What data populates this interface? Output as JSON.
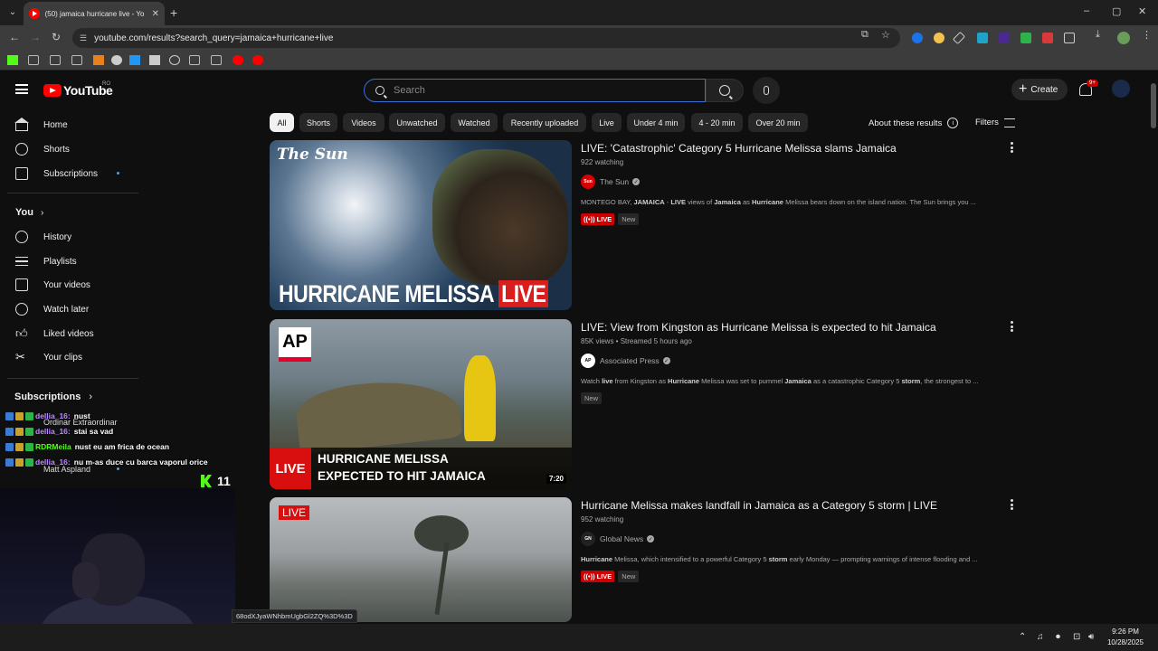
{
  "browser": {
    "tab_title": "(50) jamaica hurricane live - Yo",
    "url": "youtube.com/results?search_query=jamaica+hurricane+live",
    "window_controls": {
      "minimize": "–",
      "maximize": "▢",
      "close": "✕"
    }
  },
  "header": {
    "logo_text": "YouTube",
    "country_code": "RO",
    "search_placeholder": "Search",
    "create_label": "Create",
    "notification_count": "9+"
  },
  "sidebar": {
    "main": [
      {
        "label": "Home",
        "icon": "home-icon"
      },
      {
        "label": "Shorts",
        "icon": "shorts-icon"
      },
      {
        "label": "Subscriptions",
        "icon": "subscriptions-icon"
      }
    ],
    "you_heading": "You",
    "you_items": [
      {
        "label": "History",
        "icon": "history-icon"
      },
      {
        "label": "Playlists",
        "icon": "playlists-icon"
      },
      {
        "label": "Your videos",
        "icon": "your-videos-icon"
      },
      {
        "label": "Watch later",
        "icon": "watch-later-icon"
      },
      {
        "label": "Liked videos",
        "icon": "liked-videos-icon"
      },
      {
        "label": "Your clips",
        "icon": "clips-icon"
      }
    ],
    "subscriptions_heading": "Subscriptions",
    "subscriptions": [
      "Ordinar Extraordinar",
      "Matt Aspland"
    ]
  },
  "chips": [
    "All",
    "Shorts",
    "Videos",
    "Unwatched",
    "Watched",
    "Recently uploaded",
    "Live",
    "Under 4 min",
    "4 - 20 min",
    "Over 20 min"
  ],
  "about_results": "About these results",
  "filters_label": "Filters",
  "results": [
    {
      "title": "LIVE: 'Catastrophic' Category 5 Hurricane Melissa slams Jamaica",
      "meta": "922 watching",
      "channel": "The Sun",
      "channel_avatar_text": "Sun",
      "desc_html": "MONTEGO BAY, <b>JAMAICA</b> - <b>LIVE</b> views of <b>Jamaica</b> as <b>Hurricane</b> Melissa bears down on the island nation. The Sun brings you ...",
      "live_badge": "LIVE",
      "new_badge": "New",
      "thumb_brand": "The Sun",
      "thumb_caption": "HURRICANE MELISSA",
      "thumb_caption_live": "LIVE"
    },
    {
      "title": "LIVE: View from Kingston as Hurricane Melissa is expected to hit Jamaica",
      "meta": "85K views • Streamed 5 hours ago",
      "channel": "Associated Press",
      "channel_avatar_text": "AP",
      "desc_html": "Watch <b>live</b> from Kingston as <b>Hurricane</b> Melissa was set to pummel <b>Jamaica</b> as a catastrophic Category 5 <b>storm</b>, the strongest to ...",
      "new_badge": "New",
      "thumb_brand": "AP",
      "thumb_live": "LIVE",
      "thumb_caption_1": "HURRICANE MELISSA",
      "thumb_caption_2": "EXPECTED TO HIT JAMAICA",
      "duration": "7:20"
    },
    {
      "title": "Hurricane Melissa makes landfall in Jamaica as a Category 5 storm | LIVE",
      "meta": "952 watching",
      "channel": "Global News",
      "channel_avatar_text": "GN",
      "desc_html": "<b>Hurricane</b> Melissa, which intensified to a powerful Category 5 <b>storm</b> early Monday — prompting warnings of intense flooding and ...",
      "live_badge": "LIVE",
      "new_badge": "New",
      "thumb_live": "LIVE"
    }
  ],
  "overlay": {
    "chat": [
      {
        "user": "dellia_16:",
        "msg": "nust"
      },
      {
        "user": "dellia_16:",
        "msg": "stai sa vad"
      },
      {
        "user": "RDRMeila",
        "msg": "nust eu am frica de ocean"
      },
      {
        "user": "dellia_16:",
        "msg": "nu m-as duce cu barca vaporul orice"
      }
    ],
    "viewer_count": "11"
  },
  "status_url": "68odXJyaWNhbmUgbGl2ZQ%3D%3D",
  "taskbar": {
    "time": "9:26 PM",
    "date": "10/28/2025"
  }
}
